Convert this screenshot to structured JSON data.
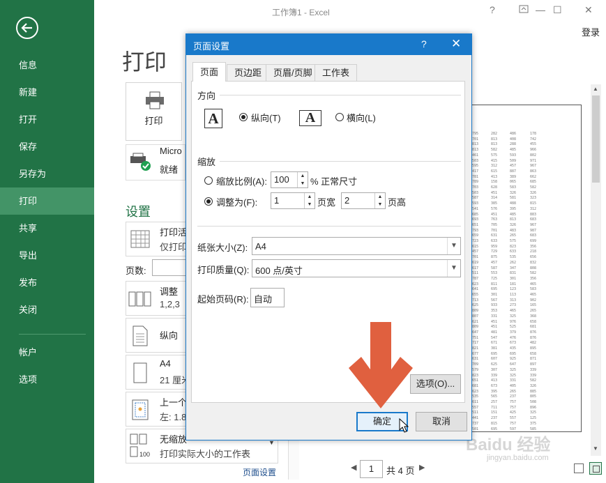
{
  "window": {
    "title": "工作簿1 - Excel",
    "signin": "登录",
    "help": "?",
    "minimize": "—",
    "maximize": "☐",
    "close": "✕"
  },
  "sidebar": {
    "items": [
      "信息",
      "新建",
      "打开",
      "保存",
      "另存为",
      "打印",
      "共享",
      "导出",
      "发布",
      "关闭"
    ],
    "lower_items": [
      "帐户",
      "选项"
    ],
    "active": "打印"
  },
  "main": {
    "heading": "打印",
    "print_button": "打印",
    "printer": {
      "name": "Micro",
      "status": "就绪"
    },
    "settings_heading": "设置",
    "settings": [
      {
        "title": "打印活",
        "sub": "仅打印"
      },
      {
        "title": "调整",
        "sub": "1,2,3"
      },
      {
        "title": "纵向",
        "sub": ""
      },
      {
        "title": "A4",
        "sub": "21 厘米"
      },
      {
        "title": "上一个",
        "sub": "左: 1.8"
      },
      {
        "title": "无缩放",
        "sub": "打印实际大小的工作表"
      }
    ],
    "pages_label": "页数:",
    "page_setup_link": "页面设置",
    "pager": {
      "current": "1",
      "total": "共 4 页"
    }
  },
  "preview_columns": [
    [
      "795",
      "701",
      "813",
      "813",
      "461",
      "503",
      "595",
      "417",
      "781",
      "789",
      "703",
      "503",
      "587",
      "593",
      "541",
      "685",
      "693",
      "651",
      "793",
      "659",
      "723",
      "615",
      "457",
      "701",
      "619",
      "617",
      "511",
      "787",
      "623",
      "641",
      "655",
      "713",
      "625",
      "809",
      "807",
      "621",
      "809",
      "647",
      "751",
      "717",
      "821",
      "677",
      "631",
      "709",
      "579",
      "823",
      "651",
      "681",
      "623",
      "535",
      "611",
      "557",
      "511",
      "441",
      "737",
      "501",
      "677",
      "479",
      "689"
    ],
    [
      "282",
      "813",
      "813",
      "582",
      "575",
      "415",
      "312",
      "615",
      "413",
      "158",
      "628",
      "451",
      "314",
      "385",
      "576",
      "451",
      "763",
      "705",
      "701",
      "631",
      "633",
      "959",
      "729",
      "875",
      "457",
      "587",
      "553",
      "725",
      "811",
      "695",
      "301",
      "567",
      "933",
      "353",
      "331",
      "451",
      "451",
      "481",
      "547",
      "671",
      "381",
      "695",
      "607",
      "625",
      "307",
      "339",
      "413",
      "673",
      "395",
      "565",
      "257",
      "711",
      "151",
      "237",
      "815",
      "695",
      "237",
      "717",
      "295"
    ],
    [
      "486",
      "408",
      "288",
      "485",
      "593",
      "509",
      "457",
      "887",
      "389",
      "065",
      "583",
      "326",
      "581",
      "488",
      "395",
      "485",
      "813",
      "326",
      "483",
      "265",
      "575",
      "823",
      "633",
      "535",
      "262",
      "347",
      "831",
      "301",
      "181",
      "123",
      "113",
      "313",
      "273",
      "465",
      "325",
      "976",
      "525",
      "379",
      "476",
      "673",
      "435",
      "695",
      "925",
      "647",
      "325",
      "325",
      "331",
      "405",
      "265",
      "237",
      "757",
      "757",
      "425",
      "557",
      "757",
      "597",
      "139",
      "571",
      "303"
    ],
    [
      "178",
      "742",
      "455",
      "966",
      "802",
      "971",
      "967",
      "863",
      "662",
      "685",
      "582",
      "326",
      "323",
      "815",
      "312",
      "883",
      "683",
      "967",
      "987",
      "683",
      "699",
      "356",
      "218",
      "656",
      "832",
      "808",
      "582",
      "356",
      "465",
      "583",
      "465",
      "902",
      "165",
      "265",
      "368",
      "658",
      "681",
      "876",
      "876",
      "482",
      "895",
      "658",
      "871",
      "897",
      "339",
      "339",
      "582",
      "326",
      "885",
      "805",
      "508",
      "896",
      "325",
      "125",
      "375",
      "585",
      "295",
      "368",
      "175"
    ]
  ],
  "dialog": {
    "title": "页面设置",
    "help": "?",
    "close": "✕",
    "tabs": [
      "页面",
      "页边距",
      "页眉/页脚",
      "工作表"
    ],
    "active_tab": "页面",
    "orientation": {
      "label": "方向",
      "portrait": "纵向(T)",
      "landscape": "横向(L)",
      "selected": "portrait",
      "icon_letter": "A"
    },
    "scaling": {
      "label": "缩放",
      "adjust_to_label": "缩放比例(A):",
      "adjust_to_value": "100",
      "adjust_to_suffix": "% 正常尺寸",
      "fit_to_label": "调整为(F):",
      "fit_wide_value": "1",
      "fit_wide_suffix": "页宽",
      "fit_tall_value": "2",
      "fit_tall_suffix": "页高",
      "selected": "fit_to"
    },
    "paper_size": {
      "label": "纸张大小(Z):",
      "value": "A4"
    },
    "print_quality": {
      "label": "打印质量(Q):",
      "value": "600 点/英寸"
    },
    "first_page_number": {
      "label": "起始页码(R):",
      "value": "自动"
    },
    "options_button": "选项(O)...",
    "ok_button": "确定",
    "cancel_button": "取消"
  },
  "annotation": {
    "arrow_color": "#e0603f"
  },
  "watermark": {
    "brand": "Baidu 经验",
    "url": "jingyan.baidu.com"
  },
  "colors": {
    "excel_green": "#217346",
    "sidebar_active": "#439467",
    "dialog_blue": "#1979ca"
  }
}
